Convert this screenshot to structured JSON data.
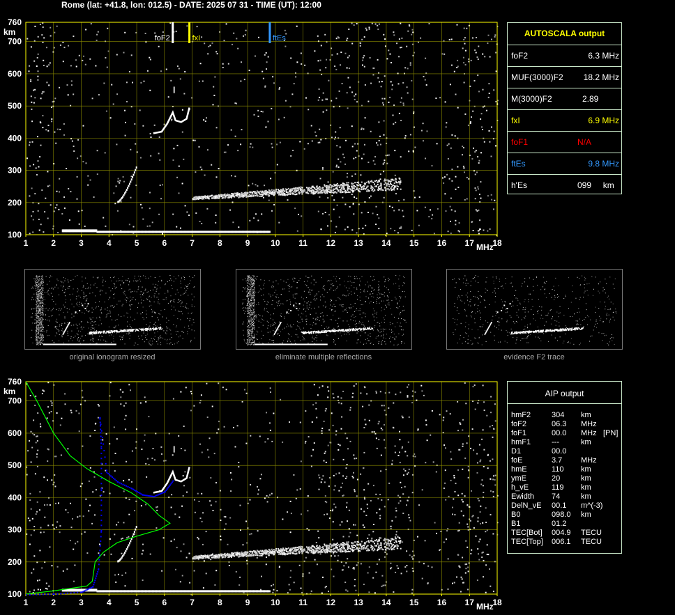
{
  "header": "Rome (lat: +41.8, lon: 012.5) - DATE: 2025 07 31 - TIME (UT): 12:00",
  "colors": {
    "grid": "#ffff00",
    "axis": "#ffff00",
    "trace": "#ffffff",
    "blue": "#0000ff",
    "green": "#00ff00",
    "red": "#ff0000",
    "es": "#3399ff",
    "panel_border": "#c8e6c8"
  },
  "chart_data": [
    {
      "type": "scatter",
      "title": "",
      "x_ticks": [
        "1",
        "2",
        "3",
        "4",
        "5",
        "6",
        "7",
        "8",
        "9",
        "10",
        "11",
        "12",
        "13",
        "14",
        "15",
        "16",
        "17",
        "18"
      ],
      "x_unit": "MHz",
      "y_ticks": [
        "100",
        "200",
        "300",
        "400",
        "500",
        "600",
        "700",
        "760"
      ],
      "y_unit": "km",
      "xlim": [
        1,
        18
      ],
      "ylim": [
        100,
        760
      ],
      "markers": [
        {
          "label": "foF2",
          "x": 6.3,
          "color": "#ffffff"
        },
        {
          "label": "fxI",
          "x": 6.9,
          "color": "#ffff00"
        },
        {
          "label": "ftEs",
          "x": 9.8,
          "color": "#3399ff"
        }
      ],
      "traces": {
        "es_layer": {
          "x_start": 2.3,
          "x_end": 9.8,
          "height": 110
        },
        "f_lower": {
          "x_start": 4.3,
          "x_end": 5.0,
          "h_start": 205,
          "h_end": 320
        },
        "f_upper": [
          [
            5.6,
            415
          ],
          [
            5.9,
            420
          ],
          [
            6.1,
            445
          ],
          [
            6.3,
            480
          ],
          [
            6.4,
            455
          ],
          [
            6.6,
            450
          ],
          [
            6.8,
            460
          ],
          [
            6.9,
            495
          ]
        ],
        "spread_f": {
          "x_start": 7.0,
          "x_end": 14.5,
          "h_start": 215,
          "h_end": 260
        }
      }
    },
    {
      "type": "line",
      "title": "",
      "x_ticks": [
        "1",
        "2",
        "3",
        "4",
        "5",
        "6",
        "7",
        "8",
        "9",
        "10",
        "11",
        "12",
        "13",
        "14",
        "15",
        "16",
        "17",
        "18"
      ],
      "x_unit": "MHz",
      "y_ticks": [
        "100",
        "200",
        "300",
        "400",
        "500",
        "600",
        "700",
        "760"
      ],
      "y_unit": "km",
      "xlim": [
        1,
        18
      ],
      "ylim": [
        100,
        760
      ],
      "profile_green": [
        [
          1.0,
          760
        ],
        [
          1.4,
          700
        ],
        [
          2.0,
          600
        ],
        [
          2.6,
          530
        ],
        [
          3.2,
          490
        ],
        [
          4.0,
          450
        ],
        [
          4.8,
          415
        ],
        [
          5.4,
          380
        ],
        [
          5.8,
          345
        ],
        [
          6.2,
          320
        ],
        [
          5.8,
          300
        ],
        [
          5.0,
          280
        ],
        [
          4.3,
          260
        ],
        [
          3.8,
          230
        ],
        [
          3.5,
          200
        ],
        [
          3.4,
          140
        ],
        [
          3.2,
          125
        ],
        [
          2.0,
          110
        ],
        [
          1.0,
          100
        ]
      ],
      "virtual_blue": [
        [
          1.0,
          100
        ],
        [
          2.0,
          102
        ],
        [
          3.0,
          108
        ],
        [
          3.4,
          125
        ],
        [
          3.6,
          180
        ],
        [
          3.7,
          300
        ],
        [
          3.7,
          430
        ],
        [
          3.7,
          560
        ],
        [
          3.65,
          650
        ],
        [
          3.9,
          480
        ],
        [
          4.3,
          450
        ],
        [
          4.8,
          430
        ],
        [
          5.2,
          410
        ],
        [
          5.6,
          405
        ],
        [
          6.0,
          420
        ],
        [
          6.3,
          455
        ]
      ]
    }
  ],
  "autoscala": {
    "title": "AUTOSCALA output",
    "rows": [
      {
        "label": "foF2",
        "value": "6.3 MHz",
        "color": "#ffffff",
        "vcolor": "#ffffff"
      },
      {
        "label": "MUF(3000)F2",
        "value": "18.2 MHz",
        "color": "#ffffff",
        "vcolor": "#ffffff"
      },
      {
        "label": "M(3000)F2",
        "value": "2.89",
        "color": "#ffffff",
        "vcolor": "#ffffff"
      },
      {
        "label": "fxI",
        "value": "6.9 MHz",
        "color": "#ffff00",
        "vcolor": "#ffff00"
      },
      {
        "label": "foF1",
        "value": "N/A",
        "color": "#ff0000",
        "vcolor": "#ff0000"
      },
      {
        "label": "ftEs",
        "value": "9.8 MHz",
        "color": "#3399ff",
        "vcolor": "#3399ff"
      },
      {
        "label": "h'Es",
        "value": "099     km",
        "color": "#ffffff",
        "vcolor": "#ffffff"
      }
    ]
  },
  "thumbnails": [
    {
      "caption": "original ionogram resized"
    },
    {
      "caption": "eliminate multiple reflections"
    },
    {
      "caption": "evidence F2 trace"
    }
  ],
  "aip": {
    "title": "AIP output",
    "rows": [
      {
        "label": "hmF2",
        "value": "304",
        "unit": "km",
        "extra": ""
      },
      {
        "label": "foF2",
        "value": "06.3",
        "unit": "MHz",
        "extra": ""
      },
      {
        "label": "foF1",
        "value": "00.0",
        "unit": "MHz",
        "extra": "[PN]"
      },
      {
        "label": "hmF1",
        "value": "---",
        "unit": "km",
        "extra": ""
      },
      {
        "label": "D1",
        "value": "00.0",
        "unit": "",
        "extra": ""
      },
      {
        "label": "foE",
        "value": "3.7",
        "unit": "MHz",
        "extra": ""
      },
      {
        "label": "hmE",
        "value": "110",
        "unit": "km",
        "extra": ""
      },
      {
        "label": "ymE",
        "value": "20",
        "unit": "km",
        "extra": ""
      },
      {
        "label": "h_vE",
        "value": "119",
        "unit": "km",
        "extra": ""
      },
      {
        "label": "Ewidth",
        "value": "74",
        "unit": "km",
        "extra": ""
      },
      {
        "label": "DelN_vE",
        "value": "00.1",
        "unit": "m^(-3)",
        "extra": ""
      },
      {
        "label": "B0",
        "value": "098.0",
        "unit": "km",
        "extra": ""
      },
      {
        "label": "B1",
        "value": "01.2",
        "unit": "",
        "extra": ""
      },
      {
        "label": "TEC[Bot]",
        "value": "004.9",
        "unit": "TECU",
        "extra": ""
      },
      {
        "label": "TEC[Top]",
        "value": "006.1",
        "unit": "TECU",
        "extra": ""
      }
    ]
  }
}
